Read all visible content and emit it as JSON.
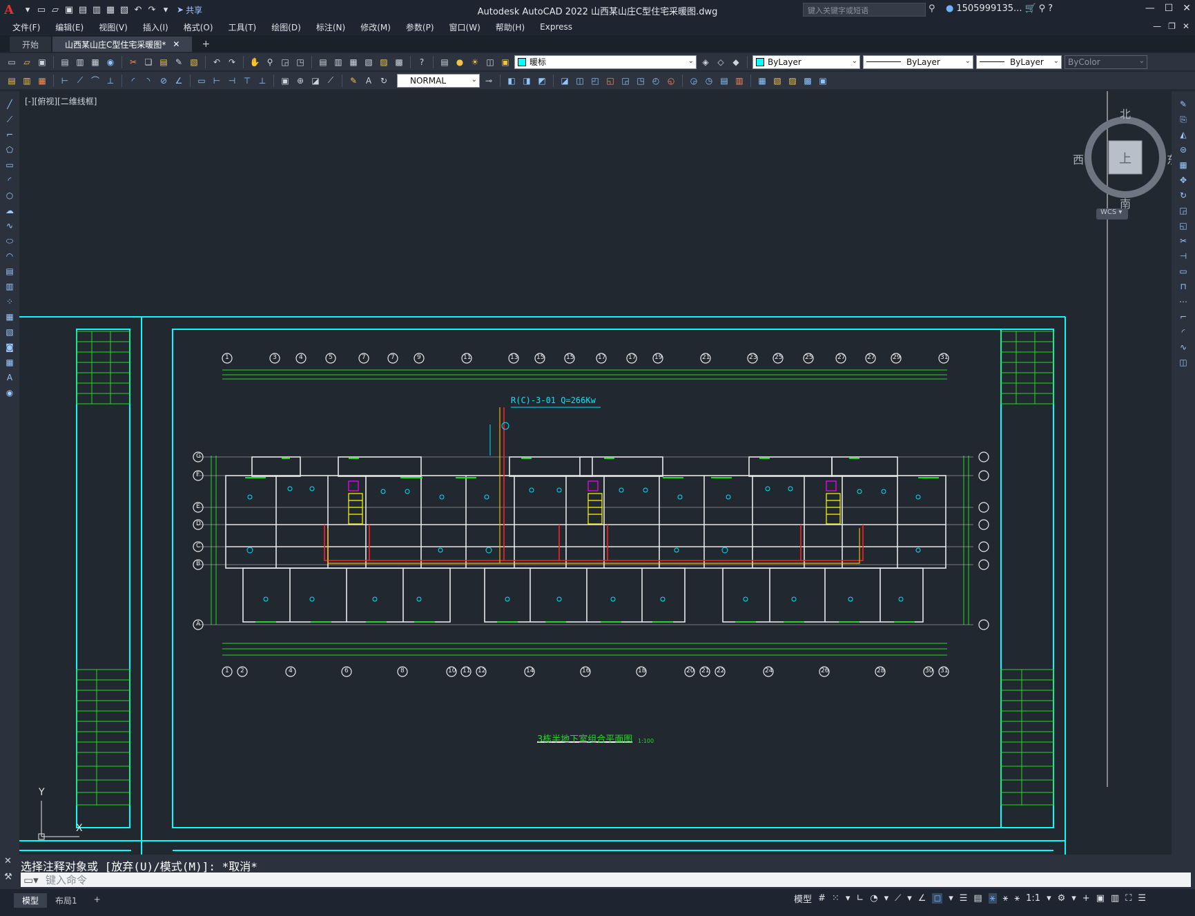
{
  "app": {
    "logo": "A",
    "title": "Autodesk AutoCAD 2022    山西某山庄C型住宅采暖图.dwg",
    "share_label": "共享",
    "search_placeholder": "键入关键字或短语",
    "user_name": "1505999135...",
    "win_controls": [
      "—",
      "☐",
      "✕"
    ]
  },
  "menu": {
    "items": [
      "文件(F)",
      "编辑(E)",
      "视图(V)",
      "插入(I)",
      "格式(O)",
      "工具(T)",
      "绘图(D)",
      "标注(N)",
      "修改(M)",
      "参数(P)",
      "窗口(W)",
      "帮助(H)",
      "Express"
    ]
  },
  "tabs": [
    {
      "label": "开始"
    },
    {
      "label": "山西某山庄C型住宅采暖图*"
    }
  ],
  "toolbar": {
    "layer_name": "暖标",
    "color_value": "ByLayer",
    "linetype_value": "ByLayer",
    "lineweight_value": "ByLayer",
    "plotstyle_value": "ByColor",
    "dimstyle_value": "NORMAL"
  },
  "canvas": {
    "view_label": "[-][俯视][二维线框]",
    "compass": {
      "north": "北",
      "south": "南",
      "east": "东",
      "west": "西",
      "top": "上",
      "ucs": "WCS"
    },
    "drawing_title": "3栋半地下室组合平面图",
    "drawing_scale": "1:100",
    "pipe_note": "R(C)-3-01 Q=266Kw",
    "axis_top": [
      "1",
      "3",
      "4",
      "5",
      "7",
      "7",
      "9",
      "11",
      "13",
      "15",
      "15",
      "17",
      "17",
      "19",
      "21",
      "23",
      "25",
      "25",
      "27",
      "27",
      "29",
      "31"
    ],
    "axis_bottom": [
      "1",
      "2",
      "4",
      "6",
      "8",
      "10",
      "11",
      "12",
      "14",
      "16",
      "18",
      "20",
      "21",
      "22",
      "24",
      "26",
      "28",
      "30",
      "31"
    ],
    "axis_rows": [
      "G",
      "F",
      "E",
      "D",
      "C",
      "B",
      "A"
    ],
    "ucs_y": "Y",
    "ucs_x": "X"
  },
  "command": {
    "history": "选择注释对象或 [放弃(U)/模式(M)]: *取消*",
    "placeholder": "键入命令"
  },
  "status": {
    "layout_tabs": [
      "模型",
      "布局1"
    ],
    "model_label": "模型",
    "scale": "1:1"
  }
}
